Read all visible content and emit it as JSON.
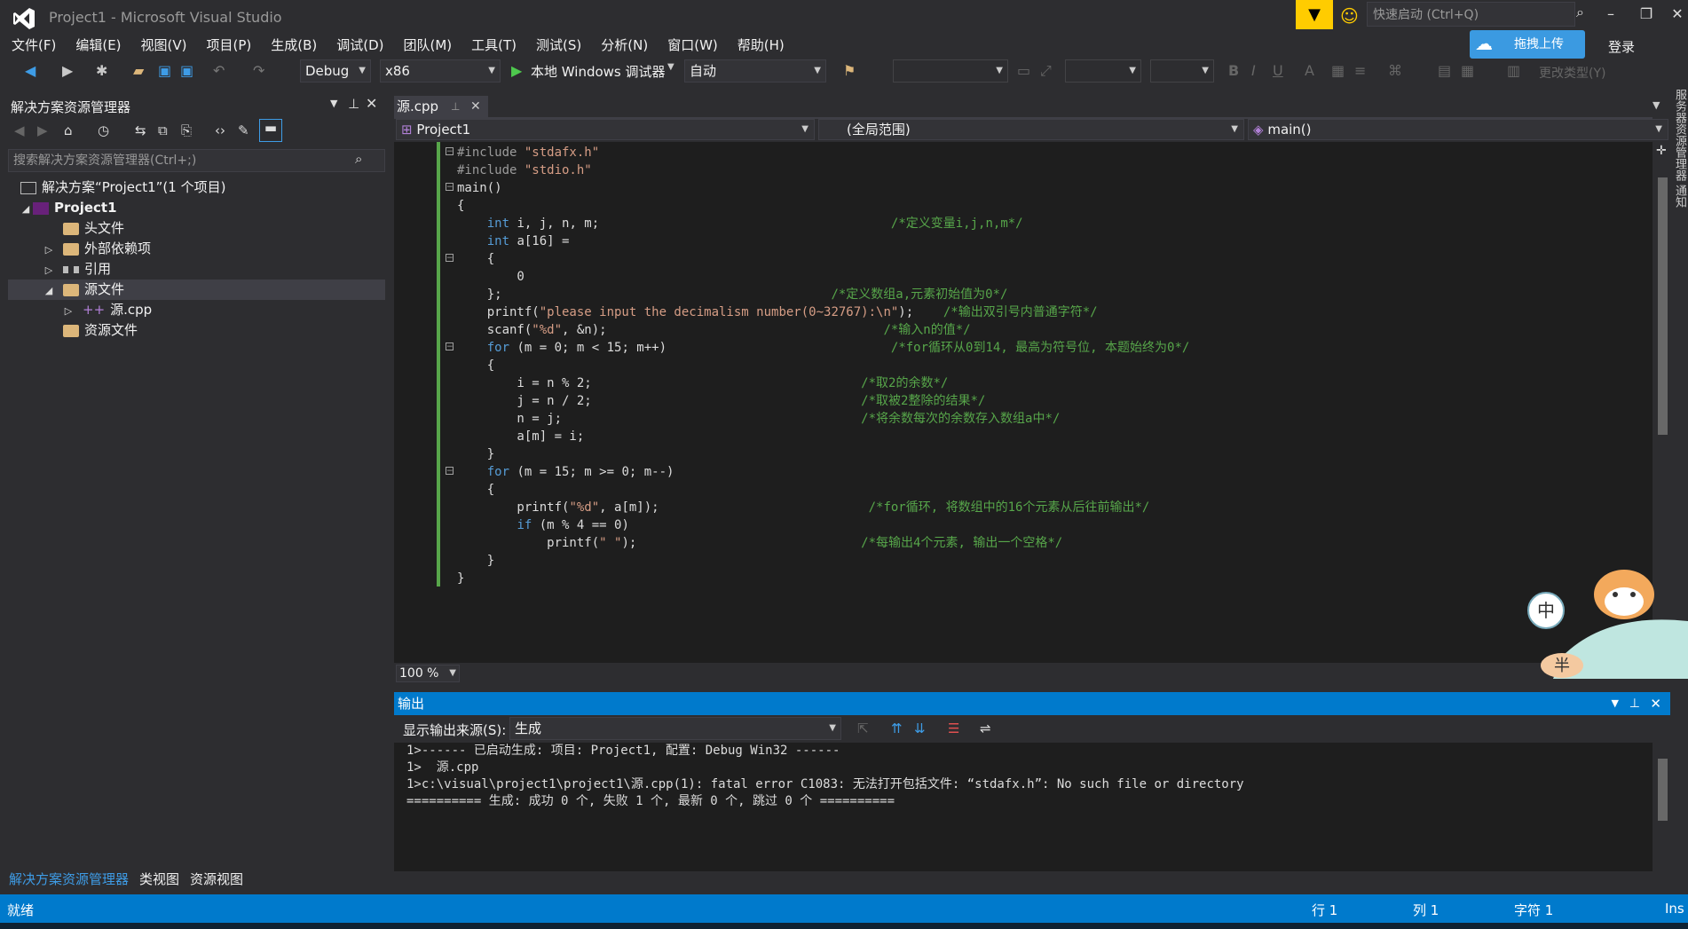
{
  "window": {
    "title": "Project1 - Microsoft Visual Studio",
    "quick_launch_placeholder": "快速启动 (Ctrl+Q)",
    "upload_label": "拖拽上传",
    "login_label": "登录"
  },
  "menu": [
    "文件(F)",
    "编辑(E)",
    "视图(V)",
    "项目(P)",
    "生成(B)",
    "调试(D)",
    "团队(M)",
    "工具(T)",
    "测试(S)",
    "分析(N)",
    "窗口(W)",
    "帮助(H)"
  ],
  "toolbar": {
    "config": "Debug",
    "platform": "x86",
    "debugger_label": "本地 Windows 调试器",
    "debugger_mode": "自动",
    "change_type_label": "更改类型(Y)",
    "bold": "B",
    "italic": "I",
    "underline": "U"
  },
  "solution_explorer": {
    "title": "解决方案资源管理器",
    "search_placeholder": "搜索解决方案资源管理器(Ctrl+;)",
    "tree": [
      {
        "label": "解决方案“Project1”(1 个项目)",
        "indent": 0,
        "twisty": "",
        "icon": "solution-icon"
      },
      {
        "label": "Project1",
        "indent": 1,
        "twisty": "◢",
        "icon": "project-icon"
      },
      {
        "label": "头文件",
        "indent": 2,
        "twisty": "",
        "icon": "folder-icon"
      },
      {
        "label": "外部依赖项",
        "indent": 2,
        "twisty": "▷",
        "icon": "folder-icon"
      },
      {
        "label": "引用",
        "indent": 2,
        "twisty": "▷",
        "icon": "references-icon"
      },
      {
        "label": "源文件",
        "indent": 2,
        "twisty": "◢",
        "icon": "folder-icon",
        "selected": true
      },
      {
        "label": "源.cpp",
        "indent": 3,
        "twisty": "▷",
        "icon": "cpp-file-icon"
      },
      {
        "label": "资源文件",
        "indent": 2,
        "twisty": "",
        "icon": "folder-icon"
      }
    ],
    "bottom_tabs": [
      "解决方案资源管理器",
      "类视图",
      "资源视图"
    ]
  },
  "editor": {
    "tab_label": "源.cpp",
    "nav_project": "Project1",
    "nav_scope": "(全局范围)",
    "nav_member": "main()",
    "zoom": "100 %",
    "code_lines": [
      "#include \"stdafx.h\"",
      "#include \"stdio.h\"",
      "main()",
      "{",
      "    int i, j, n, m;                                       /*定义变量i,j,n,m*/",
      "    int a[16] =",
      "    {",
      "        0",
      "    };                                            /*定义数组a,元素初始值为0*/",
      "    printf(\"please input the decimalism number(0~32767):\\n\");    /*输出双引号内普通字符*/",
      "    scanf(\"%d\", &n);                                     /*输入n的值*/",
      "    for (m = 0; m < 15; m++)                              /*for循环从0到14, 最高为符号位, 本题始终为0*/",
      "    {",
      "        i = n % 2;                                    /*取2的余数*/",
      "        j = n / 2;                                    /*取被2整除的结果*/",
      "        n = j;                                        /*将余数每次的余数存入数组a中*/",
      "        a[m] = i;",
      "    }",
      "    for (m = 15; m >= 0; m--)",
      "    {",
      "        printf(\"%d\", a[m]);                            /*for循环, 将数组中的16个元素从后往前输出*/",
      "        if (m % 4 == 0)",
      "            printf(\" \");                              /*每输出4个元素, 输出一个空格*/",
      "    }",
      "}"
    ]
  },
  "output": {
    "title": "输出",
    "source_label": "显示输出来源(S):",
    "source_value": "生成",
    "lines": [
      "1>------ 已启动生成: 项目: Project1, 配置: Debug Win32 ------",
      "1>  源.cpp",
      "1>c:\\visual\\project1\\project1\\源.cpp(1): fatal error C1083: 无法打开包括文件: “stdafx.h”: No such file or directory",
      "========== 生成: 成功 0 个, 失败 1 个, 最新 0 个, 跳过 0 个 =========="
    ]
  },
  "statusbar": {
    "ready": "就绪",
    "row": "行 1",
    "col": "列 1",
    "char": "字符 1",
    "ins": "Ins"
  },
  "right_strip_text": "服务器资源管理器 通知",
  "sticker": {
    "badge_1": "中",
    "badge_2": "半"
  },
  "colors": {
    "accent": "#007acc",
    "comment": "#57a64a",
    "keyword": "#569cd6",
    "string": "#d69d85"
  }
}
